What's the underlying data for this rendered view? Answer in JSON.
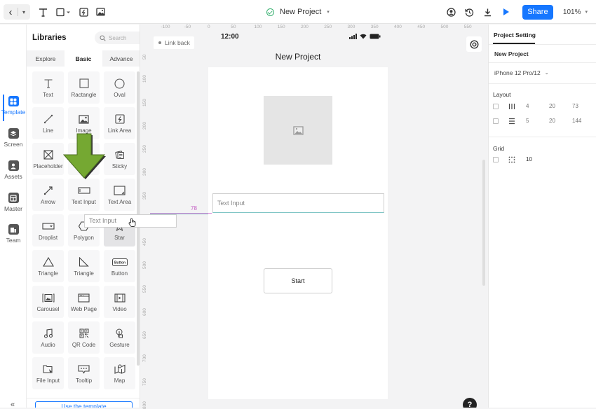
{
  "toolbar": {
    "back_icon": "chevron-left-icon",
    "tools": [
      "text-tool-icon",
      "rectangle-tool-icon",
      "link-area-tool-icon",
      "image-tool-icon"
    ],
    "project_title": "New Project",
    "right_icons": [
      "user-icon",
      "history-icon",
      "download-icon",
      "play-icon"
    ],
    "share_label": "Share",
    "zoom_value": "101%"
  },
  "rail": {
    "items": [
      {
        "label": "Template",
        "icon": "template-icon",
        "active": true
      },
      {
        "label": "Screen",
        "icon": "layers-icon"
      },
      {
        "label": "Assets",
        "icon": "assets-icon"
      },
      {
        "label": "Master",
        "icon": "master-icon"
      },
      {
        "label": "Team",
        "icon": "team-icon"
      }
    ],
    "collapse_label": "«"
  },
  "libraries": {
    "title": "Libraries",
    "search_placeholder": "Search",
    "tabs": [
      {
        "label": "Explore"
      },
      {
        "label": "Basic",
        "active": true
      },
      {
        "label": "Advance"
      }
    ],
    "items": [
      {
        "label": "Text"
      },
      {
        "label": "Ractangle"
      },
      {
        "label": "Oval"
      },
      {
        "label": "Line"
      },
      {
        "label": "Image"
      },
      {
        "label": "Link Area"
      },
      {
        "label": "Placeholder"
      },
      {
        "label": ""
      },
      {
        "label": "Sticky"
      },
      {
        "label": "Arrow"
      },
      {
        "label": "Text Input"
      },
      {
        "label": "Text Area"
      },
      {
        "label": "Droplist"
      },
      {
        "label": "Polygon"
      },
      {
        "label": "Star"
      },
      {
        "label": "Triangle"
      },
      {
        "label": "Triangle"
      },
      {
        "label": "Button"
      },
      {
        "label": "Carousel"
      },
      {
        "label": "Web Page"
      },
      {
        "label": "Video"
      },
      {
        "label": "Audio"
      },
      {
        "label": "QR Code"
      },
      {
        "label": "Gesture"
      },
      {
        "label": "File Input"
      },
      {
        "label": "Tooltip"
      },
      {
        "label": "Map"
      }
    ],
    "button_icon_text": "Button",
    "use_template_label": "Use the template"
  },
  "rulers": {
    "horizontal": [
      "-100",
      "-50",
      "0",
      "50",
      "100",
      "150",
      "200",
      "250",
      "300",
      "350",
      "400",
      "450",
      "500",
      "550"
    ],
    "vertical": [
      "50",
      "100",
      "150",
      "200",
      "250",
      "300",
      "350",
      "400",
      "450",
      "500",
      "550",
      "600",
      "650",
      "700",
      "750",
      "800"
    ]
  },
  "canvas": {
    "link_back_label": "Link back",
    "status_time": "12:00",
    "screen_title": "New Project",
    "text_input_placeholder": "Text Input",
    "start_button_label": "Start",
    "guide_distance": "78",
    "drag_ghost_label": "Text Input",
    "help_label": "?"
  },
  "right_panel": {
    "tab_label": "Project Setting",
    "project_name": "New Project",
    "device": "iPhone 12 Pro/12",
    "layout_title": "Layout",
    "layout_rows": [
      {
        "icon": "columns-icon",
        "count": "4",
        "gutter": "20",
        "width": "73"
      },
      {
        "icon": "rows-icon",
        "count": "5",
        "gutter": "20",
        "width": "144"
      }
    ],
    "grid_title": "Grid",
    "grid_value": "10"
  }
}
